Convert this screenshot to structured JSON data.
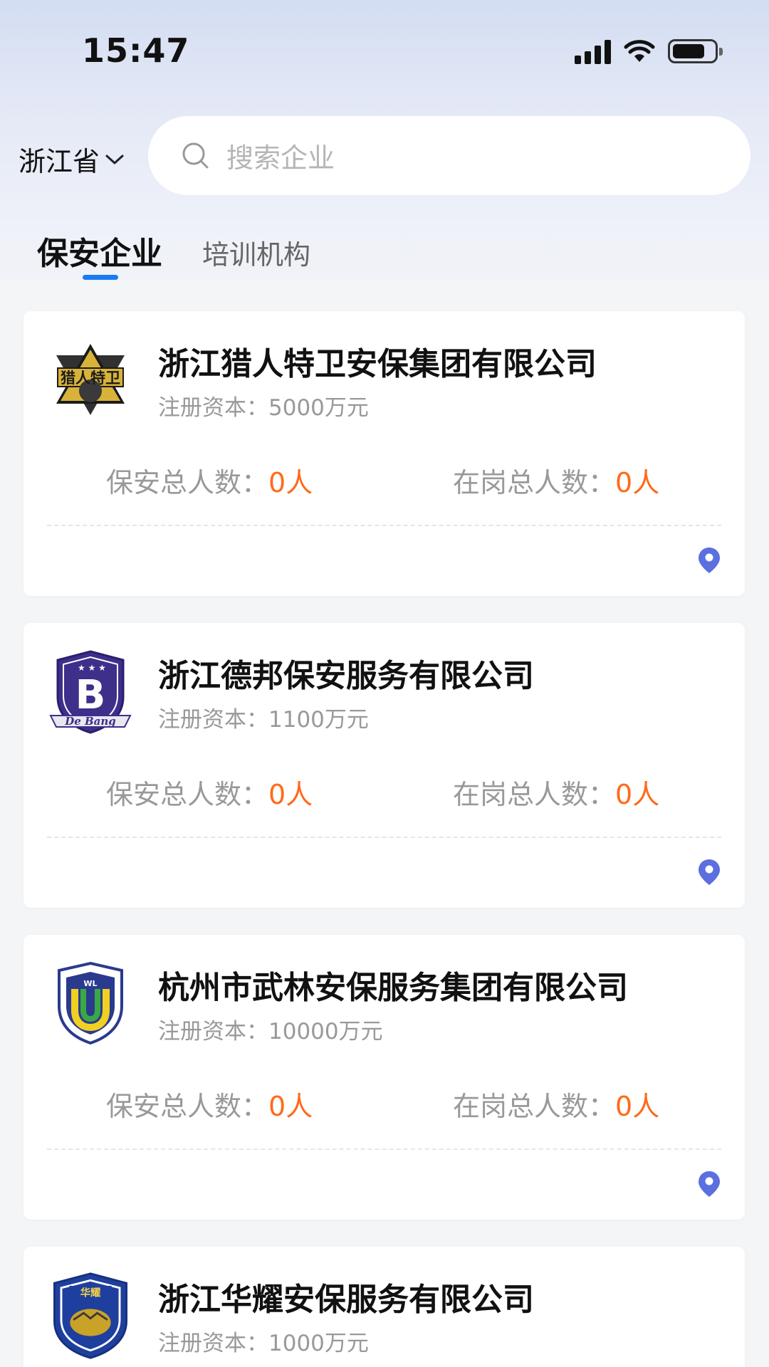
{
  "status": {
    "time": "15:47"
  },
  "header": {
    "province": "浙江省",
    "search_placeholder": "搜索企业"
  },
  "tabs": [
    {
      "label": "保安企业",
      "active": true
    },
    {
      "label": "培训机构",
      "active": false
    }
  ],
  "stat_labels": {
    "guards": "保安总人数：",
    "on_duty": "在岗总人数："
  },
  "companies": [
    {
      "name": "浙江猎人特卫安保集团有限公司",
      "capital": "注册资本：5000万元",
      "guards": "0人",
      "on_duty": "0人",
      "logo_text": "猎人特卫"
    },
    {
      "name": "浙江德邦保安服务有限公司",
      "capital": "注册资本：1100万元",
      "guards": "0人",
      "on_duty": "0人",
      "logo_text": "De Bang"
    },
    {
      "name": "杭州市武林安保服务集团有限公司",
      "capital": "注册资本：10000万元",
      "guards": "0人",
      "on_duty": "0人",
      "logo_text": "WL"
    },
    {
      "name": "浙江华耀安保服务有限公司",
      "capital": "注册资本：1000万元",
      "guards": "",
      "on_duty": "",
      "logo_text": "华耀"
    }
  ],
  "colors": {
    "accent": "#1a7cf0",
    "value": "#ff6a1a",
    "pin": "#5b6fe0"
  }
}
